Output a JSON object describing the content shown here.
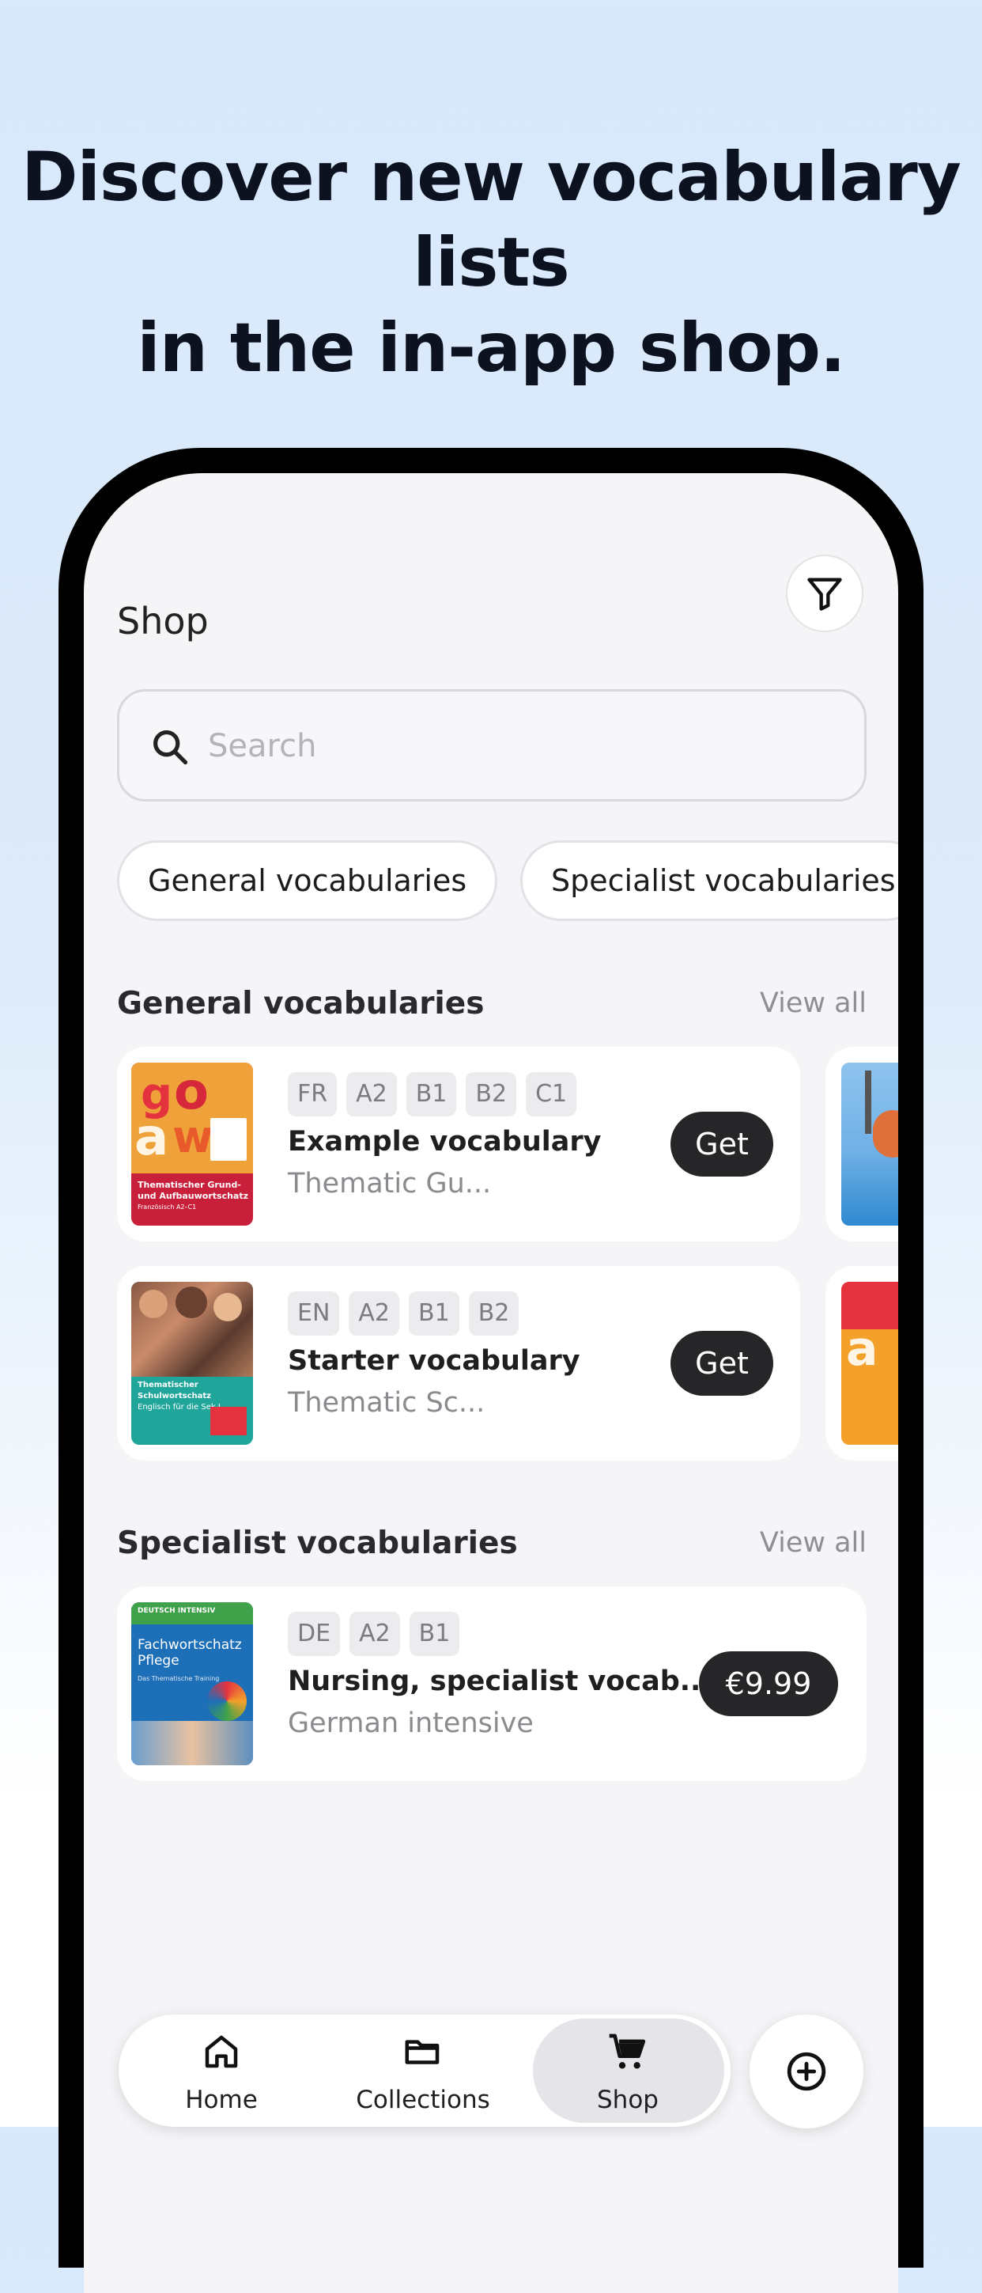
{
  "headline": {
    "line1": "Discover new vocabulary lists",
    "line2": "in the in-app shop."
  },
  "header": {
    "title": "Shop",
    "filter_icon": "filter-icon"
  },
  "search": {
    "placeholder": "Search",
    "icon": "search-icon"
  },
  "chips": [
    {
      "label": "General vocabularies"
    },
    {
      "label": "Specialist vocabularies"
    }
  ],
  "sections": {
    "general": {
      "title": "General vocabularies",
      "view_all": "View all",
      "items": [
        {
          "tags": [
            "FR",
            "A2",
            "B1",
            "B2",
            "C1"
          ],
          "title": "Example vocabulary",
          "subtitle": "Thematic Gu...",
          "action": "Get"
        },
        {
          "tags": [
            "EN",
            "A2",
            "B1",
            "B2"
          ],
          "title": "Starter vocabulary",
          "subtitle": "Thematic Sc...",
          "action": "Get"
        }
      ]
    },
    "specialist": {
      "title": "Specialist vocabularies",
      "view_all": "View all",
      "items": [
        {
          "tags": [
            "DE",
            "A2",
            "B1"
          ],
          "title": "Nursing, specialist vocab...",
          "subtitle": "German intensive",
          "action": "€9.99"
        }
      ]
    }
  },
  "covers": {
    "cover1": {
      "line1": "Thematischer Grund-",
      "line2": "und Aufbauwortschatz",
      "line3": "Französisch A2–C1"
    },
    "cover2": {
      "line1": "Thematischer Schulwortschatz",
      "line2": "Englisch für die Sek I"
    },
    "cover3": {
      "badge": "DEUTSCH INTENSIV",
      "line1": "Fachwortschatz",
      "line2": "Pflege",
      "line3": "Das Thematische Training"
    }
  },
  "nav": {
    "items": [
      {
        "label": "Home",
        "icon": "home-icon"
      },
      {
        "label": "Collections",
        "icon": "folder-icon"
      },
      {
        "label": "Shop",
        "icon": "cart-icon",
        "active": true
      }
    ],
    "add_icon": "plus-circle-icon"
  },
  "colors": {
    "accent_dark": "#262628",
    "background_top": "#d8e9fc"
  }
}
